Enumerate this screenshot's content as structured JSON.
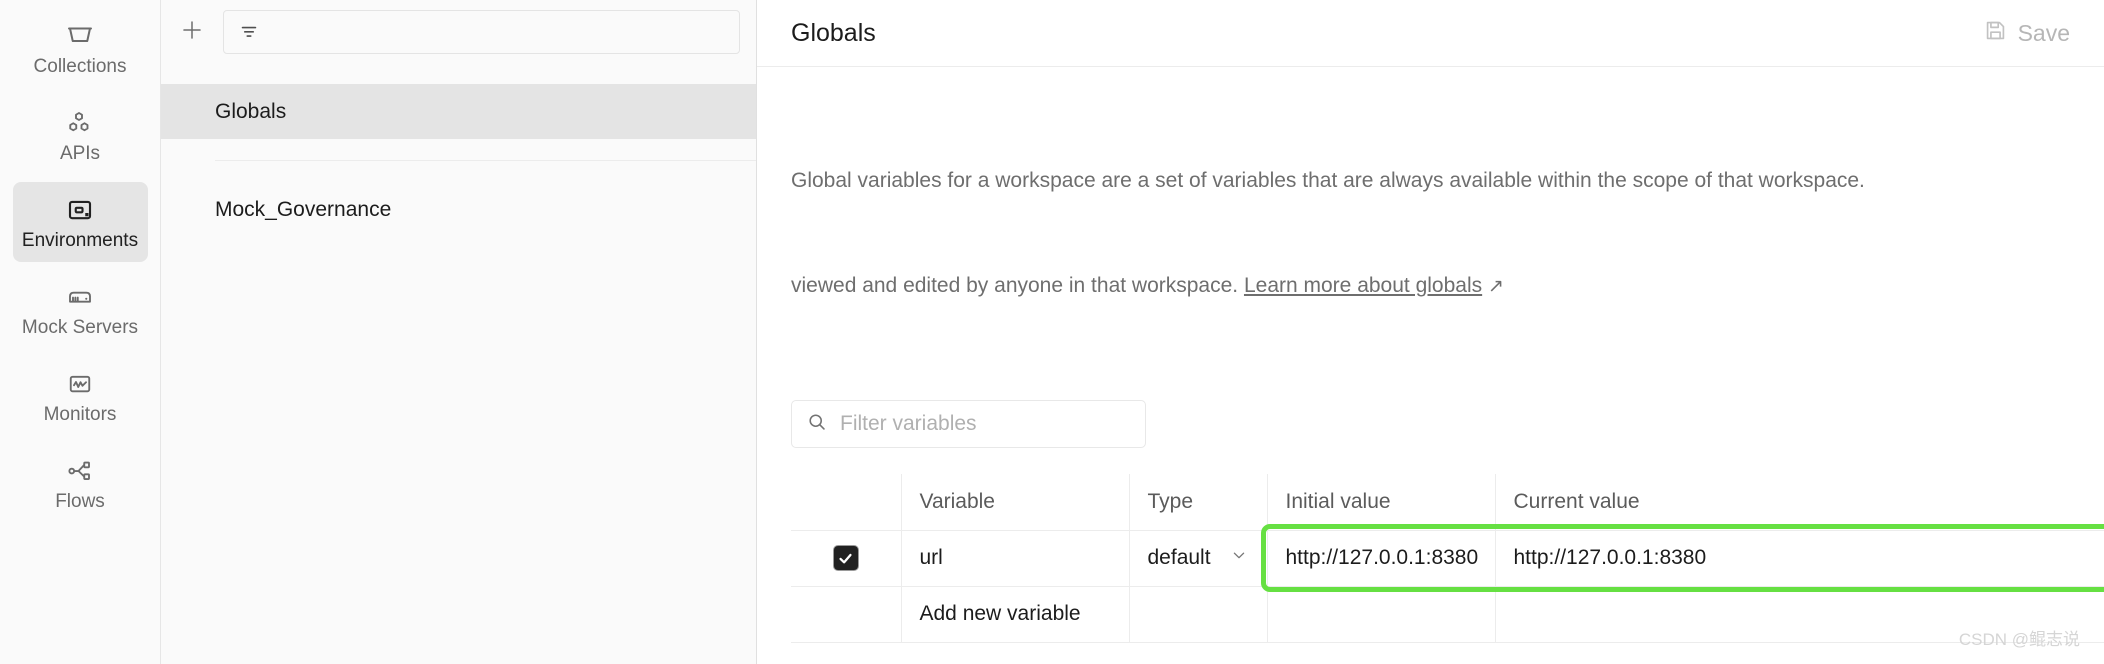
{
  "rail": {
    "items": [
      {
        "label": "Collections",
        "icon": "collections-icon",
        "active": false
      },
      {
        "label": "APIs",
        "icon": "apis-icon",
        "active": false
      },
      {
        "label": "Environments",
        "icon": "environments-icon",
        "active": true
      },
      {
        "label": "Mock Servers",
        "icon": "mock-servers-icon",
        "active": false
      },
      {
        "label": "Monitors",
        "icon": "monitors-icon",
        "active": false
      },
      {
        "label": "Flows",
        "icon": "flows-icon",
        "active": false
      }
    ]
  },
  "env_panel": {
    "add_icon": "plus-icon",
    "filter_icon": "filter-lines-icon",
    "filter_value": "",
    "filter_placeholder": "",
    "items": [
      {
        "label": "Globals",
        "selected": true
      },
      {
        "label": "Mock_Governance",
        "selected": false
      }
    ]
  },
  "main": {
    "title": "Globals",
    "save_label": "Save",
    "save_icon": "floppy-disk-icon",
    "description_line1": "Global variables for a workspace are a set of variables that are always available within the scope of that workspace.",
    "description_line2_pre": "viewed and edited by anyone in that workspace. ",
    "description_link": "Learn more about globals",
    "description_link_arrow": "↗",
    "filter": {
      "icon": "search-icon",
      "placeholder": "Filter variables",
      "value": ""
    },
    "table": {
      "columns": [
        "",
        "Variable",
        "Type",
        "Initial value",
        "Current value"
      ],
      "rows": [
        {
          "checked": true,
          "variable": "url",
          "type": "default",
          "type_chevron": "chevron-down-icon",
          "initial_value": "http://127.0.0.1:8380",
          "current_value": "http://127.0.0.1:8380"
        }
      ],
      "add_row_placeholder": "Add new variable"
    },
    "annotation_color": "#66e042"
  },
  "watermark": "CSDN @鲲志说"
}
